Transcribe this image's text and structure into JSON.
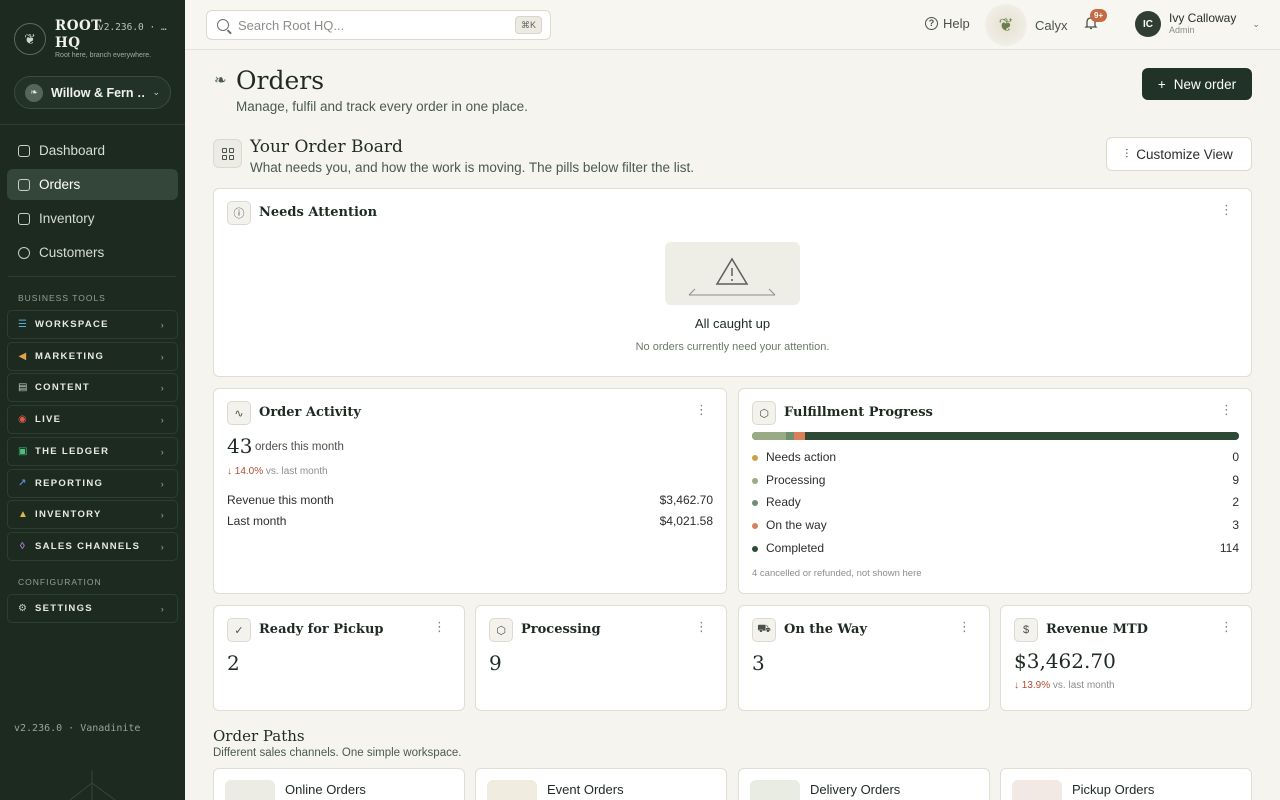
{
  "brand": {
    "name": "ROOT HQ",
    "version": "v2.236.0 · …",
    "tagline": "Root here, branch everywhere.",
    "store": "Willow & Fern …"
  },
  "nav": [
    {
      "label": "Dashboard",
      "icon": "grid-icon",
      "active": false
    },
    {
      "label": "Orders",
      "icon": "box-icon",
      "active": true
    },
    {
      "label": "Inventory",
      "icon": "clipboard-icon",
      "active": false
    },
    {
      "label": "Customers",
      "icon": "people-icon",
      "active": false
    }
  ],
  "business_tools_label": "BUSINESS TOOLS",
  "tools": [
    {
      "label": "WORKSPACE",
      "icon": "checklist-icon",
      "color": "#5aa9d8"
    },
    {
      "label": "MARKETING",
      "icon": "megaphone-icon",
      "color": "#e0a24a"
    },
    {
      "label": "CONTENT",
      "icon": "document-icon",
      "color": "#c9d1c6"
    },
    {
      "label": "LIVE",
      "icon": "broadcast-icon",
      "color": "#e05a4a"
    },
    {
      "label": "THE LEDGER",
      "icon": "ledger-icon",
      "color": "#4ac07a"
    },
    {
      "label": "REPORTING",
      "icon": "chart-icon",
      "color": "#5a8ad8"
    },
    {
      "label": "INVENTORY",
      "icon": "boxes-icon",
      "color": "#e0b84a"
    },
    {
      "label": "SALES CHANNELS",
      "icon": "channels-icon",
      "color": "#b07ad8"
    }
  ],
  "configuration_label": "CONFIGURATION",
  "settings_label": "SETTINGS",
  "footer_version": "v2.236.0 · Vanadinite",
  "topbar": {
    "search_placeholder": "Search Root HQ...",
    "search_shortcut": "⌘K",
    "help": "Help",
    "assistant": "Calyx",
    "notifications_badge": "9+",
    "user_initials": "IC",
    "user_name": "Ivy Calloway",
    "user_role": "Admin"
  },
  "page": {
    "title": "Orders",
    "subtitle": "Manage, fulfil and track every order in one place.",
    "new_order": "New order",
    "board_title": "Your Order Board",
    "board_subtitle": "What needs you, and how the work is moving. The pills below filter the list.",
    "customize": "Customize View"
  },
  "needs_attention": {
    "title": "Needs Attention",
    "empty_title": "All caught up",
    "empty_sub": "No orders currently need your attention."
  },
  "order_activity": {
    "title": "Order Activity",
    "count": "43",
    "count_label": "orders this month",
    "delta": "↓ 14.0%",
    "delta_suffix": "vs. last month",
    "revenue_label": "Revenue this month",
    "revenue_value": "$3,462.70",
    "last_month_label": "Last month",
    "last_month_value": "$4,021.58"
  },
  "fulfillment": {
    "title": "Fulfillment Progress",
    "rows": [
      {
        "label": "Needs action",
        "value": 0,
        "color": "#c9a24a"
      },
      {
        "label": "Processing",
        "value": 9,
        "color": "#9aaa85"
      },
      {
        "label": "Ready",
        "value": 2,
        "color": "#6f8f6f"
      },
      {
        "label": "On the way",
        "value": 3,
        "color": "#d9805a"
      },
      {
        "label": "Completed",
        "value": 114,
        "color": "#2e4a35"
      }
    ],
    "note": "4 cancelled or refunded, not shown here"
  },
  "stat_cards": [
    {
      "title": "Ready for Pickup",
      "icon": "check-circle-icon",
      "value": "2"
    },
    {
      "title": "Processing",
      "icon": "box-icon",
      "value": "9"
    },
    {
      "title": "On the Way",
      "icon": "truck-icon",
      "value": "3"
    },
    {
      "title": "Revenue MTD",
      "icon": "dollar-icon",
      "value": "$3,462.70",
      "delta": "↓ 13.9%",
      "delta_suffix": "vs. last month"
    }
  ],
  "order_paths": {
    "title": "Order Paths",
    "subtitle": "Different sales channels. One simple workspace.",
    "items": [
      "Online Orders",
      "Event Orders",
      "Delivery Orders",
      "Pickup Orders"
    ]
  }
}
